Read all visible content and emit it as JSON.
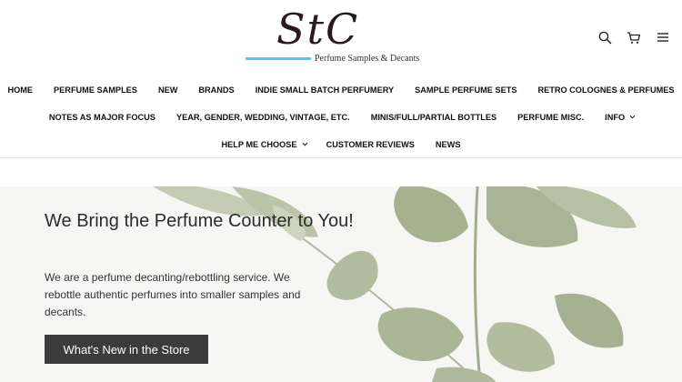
{
  "logo": {
    "mark": "StC",
    "tagline": "Perfume Samples & Decants",
    "accent_color": "#5bc8e0"
  },
  "header_icons": [
    {
      "name": "search-icon"
    },
    {
      "name": "cart-icon"
    },
    {
      "name": "menu-icon"
    }
  ],
  "nav": {
    "row1": [
      {
        "label": "HOME"
      },
      {
        "label": "PERFUME SAMPLES"
      },
      {
        "label": "NEW"
      },
      {
        "label": "BRANDS"
      },
      {
        "label": "INDIE SMALL BATCH PERFUMERY"
      },
      {
        "label": "SAMPLE PERFUME SETS"
      },
      {
        "label": "RETRO COLOGNES & PERFUMES"
      }
    ],
    "row2": [
      {
        "label": "NOTES AS MAJOR FOCUS"
      },
      {
        "label": "YEAR, GENDER, WEDDING, VINTAGE, ETC."
      },
      {
        "label": "MINIS/FULL/PARTIAL BOTTLES"
      },
      {
        "label": "PERFUME MISC."
      },
      {
        "label": "INFO"
      }
    ],
    "row3": [
      {
        "label": "HELP ME CHOOSE"
      },
      {
        "label": "CUSTOMER REVIEWS"
      },
      {
        "label": "NEWS"
      }
    ]
  },
  "hero": {
    "title": "We Bring the Perfume Counter to You!",
    "body": "We are a perfume decanting/rebottling service. We rebottle authentic perfumes into smaller samples and decants.",
    "button_label": "What's New in the Store",
    "button_color": "#3b3b3b"
  }
}
